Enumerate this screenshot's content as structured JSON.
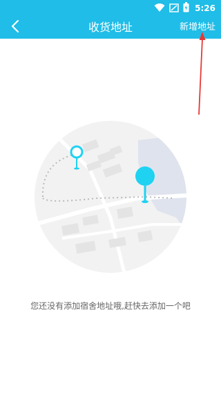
{
  "status_bar": {
    "time": "5:26",
    "icons": [
      "wifi-icon",
      "signal-icon",
      "battery-icon"
    ]
  },
  "nav": {
    "back_icon": "chevron-left-icon",
    "title": "收货地址",
    "add_button_label": "新增地址"
  },
  "empty_state": {
    "illustration": "map-illustration",
    "message": "您还没有添加宿舍地址哦,赶快去添加一个吧"
  },
  "colors": {
    "primary": "#1fbde7",
    "pin": "#1fd2f2",
    "annotation": "#e53935",
    "text_secondary": "#666666"
  }
}
